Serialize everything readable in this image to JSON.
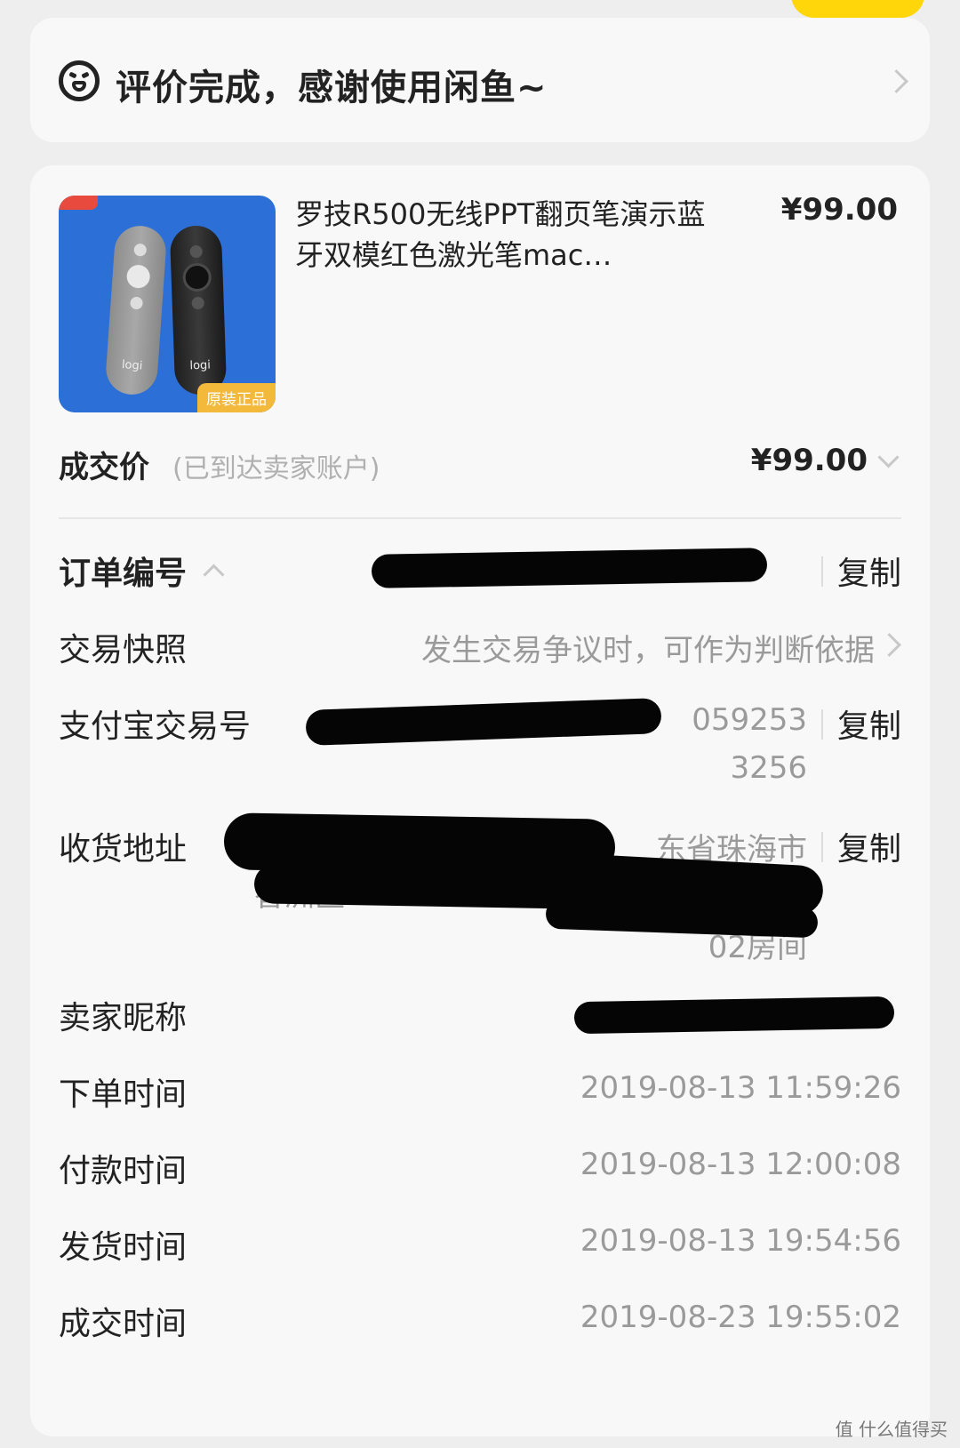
{
  "status": {
    "text": "评价完成，感谢使用闲鱼~"
  },
  "product": {
    "title": "罗技R500无线PPT翻页笔演示蓝牙双模红色激光笔mac…",
    "price": "¥99.00",
    "image_tag": "原装正品",
    "remote_logo": "logi"
  },
  "deal": {
    "label": "成交价",
    "note": "(已到达卖家账户)",
    "price": "¥99.00"
  },
  "details": {
    "order_no": {
      "label": "订单编号",
      "copy": "复制"
    },
    "snapshot": {
      "label": "交易快照",
      "value": "发生交易争议时，可作为判断依据"
    },
    "alipay_no": {
      "label": "支付宝交易号",
      "value_line1": "059253",
      "value_line2": "3256",
      "copy": "复制"
    },
    "address": {
      "label": "收货地址",
      "value_line1": "东省珠海市",
      "value_line2": "香洲区",
      "value_line3": "02房间",
      "copy": "复制"
    },
    "seller": {
      "label": "卖家昵称"
    },
    "order_time": {
      "label": "下单时间",
      "value": "2019-08-13 11:59:26"
    },
    "pay_time": {
      "label": "付款时间",
      "value": "2019-08-13 12:00:08"
    },
    "ship_time": {
      "label": "发货时间",
      "value": "2019-08-13 19:54:56"
    },
    "deal_time": {
      "label": "成交时间",
      "value": "2019-08-23 19:55:02"
    }
  },
  "watermark": "值 什么值得买"
}
